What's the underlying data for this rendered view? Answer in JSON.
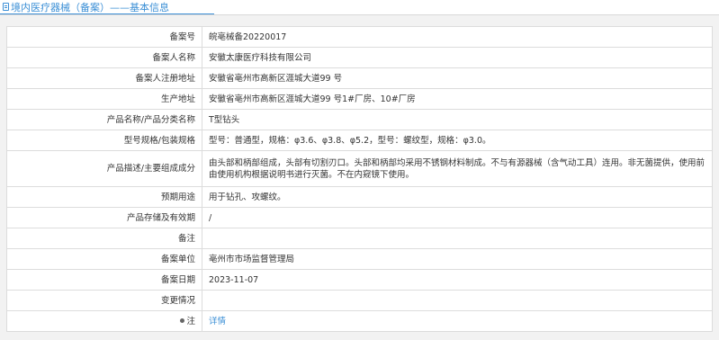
{
  "header": {
    "title": "境内医疗器械（备案）",
    "subtitle": "——基本信息",
    "icon": "document-icon",
    "accent_color": "#3b8fd6"
  },
  "rows": [
    {
      "label": "备案号",
      "value": "皖亳械备20220017"
    },
    {
      "label": "备案人名称",
      "value": "安徽太康医疗科技有限公司"
    },
    {
      "label": "备案人注册地址",
      "value": "安徽省亳州市高新区涯城大道99 号"
    },
    {
      "label": "生产地址",
      "value": "安徽省亳州市高新区涯城大道99 号1#厂房、10#厂房"
    },
    {
      "label": "产品名称/产品分类名称",
      "value": "T型钻头"
    },
    {
      "label": "型号规格/包装规格",
      "value": "型号：普通型，规格：φ3.6、φ3.8、φ5.2，型号：螺纹型，规格：φ3.0。"
    },
    {
      "label": "产品描述/主要组成成分",
      "value": "由头部和柄部组成，头部有切割刃口。头部和柄部均采用不锈钢材料制成。不与有源器械（含气动工具）连用。非无菌提供，使用前由使用机构根据说明书进行灭菌。不在内窥镜下使用。"
    },
    {
      "label": "预期用途",
      "value": "用于钻孔、攻螺纹。"
    },
    {
      "label": "产品存储及有效期",
      "value": "/"
    },
    {
      "label": "备注",
      "value": ""
    },
    {
      "label": "备案单位",
      "value": "亳州市市场监督管理局"
    },
    {
      "label": "备案日期",
      "value": "2023-11-07"
    },
    {
      "label": "变更情况",
      "value": ""
    },
    {
      "label": "注",
      "value": "详情",
      "icon": "pin-icon"
    }
  ]
}
